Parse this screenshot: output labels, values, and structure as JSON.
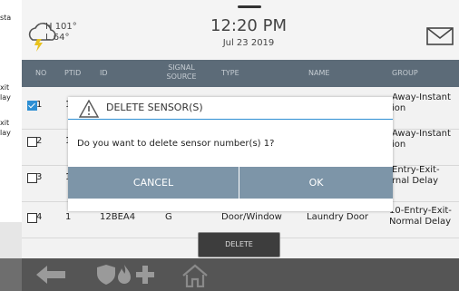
{
  "left_strip": {
    "fragments": [
      "sta",
      "xit",
      "lay",
      "xit",
      "lay"
    ]
  },
  "header": {
    "weather_icon": "cloud-lightning-icon",
    "temp_high": "H 101°",
    "temp_low": "L 64°",
    "time": "12:20 PM",
    "date": "Jul 23 2019",
    "mail_icon": "envelope-icon"
  },
  "table": {
    "columns": {
      "no": "NO",
      "ptid": "PTID",
      "id": "ID",
      "signal_source_1": "SIGNAL",
      "signal_source_2": "SOURCE",
      "type": "TYPE",
      "name": "NAME",
      "group": "GROUP"
    },
    "rows": [
      {
        "checked": true,
        "no": "1",
        "ptid": "1",
        "group_1": "Away-Instant",
        "group_2": "ion"
      },
      {
        "checked": false,
        "no": "2",
        "ptid": "1",
        "group_1": "Away-Instant",
        "group_2": "ion"
      },
      {
        "checked": false,
        "no": "3",
        "ptid": "1",
        "group_1": "Entry-Exit-",
        "group_2": "rnal Delay"
      },
      {
        "checked": false,
        "no": "4",
        "ptid": "1",
        "id": "12BEA4",
        "signal": "G",
        "type": "Door/Window",
        "name": "Laundry Door",
        "group_1": "10-Entry-Exit-",
        "group_2": "Normal Delay"
      }
    ]
  },
  "dialog": {
    "icon": "warning-icon",
    "title": "DELETE SENSOR(S)",
    "message": "Do you want to delete sensor number(s) 1?",
    "cancel_label": "CANCEL",
    "ok_label": "OK"
  },
  "delete_label": "DELETE",
  "navbar": {
    "back_icon": "back-arrow-icon",
    "security_icons": "shield-fire-medical-icons",
    "home_icon": "home-icon"
  },
  "colors": {
    "header_row": "#5c6b78",
    "dialog_buttons": "#7d95a8",
    "accent": "#2e8fd3",
    "nav": "#555555"
  }
}
